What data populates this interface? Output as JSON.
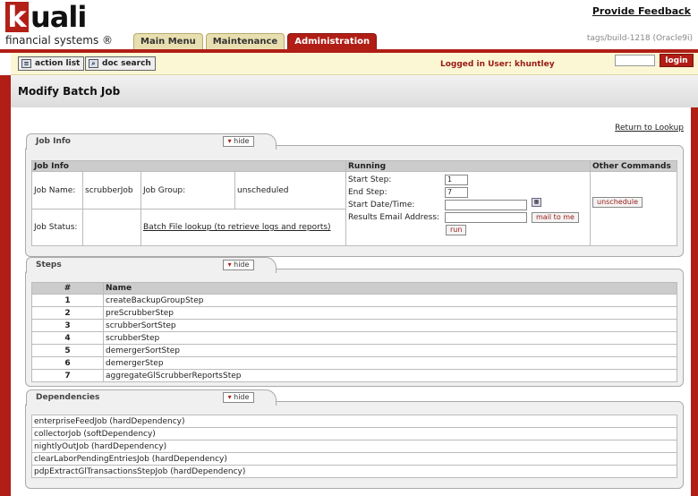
{
  "header": {
    "logo_word": "uali",
    "logo_k": "k",
    "logo_sub": "financial systems ®",
    "feedback_link": "Provide Feedback",
    "build": "tags/build-1218 (Oracle9i)",
    "tabs": [
      {
        "label": "Main Menu"
      },
      {
        "label": "Maintenance"
      },
      {
        "label": "Administration"
      }
    ]
  },
  "toolbar": {
    "action_list": "action list",
    "doc_search": "doc search",
    "logged_in": "Logged in User: khuntley",
    "login_label": "login"
  },
  "page": {
    "title": "Modify Batch Job",
    "return_link": "Return to Lookup"
  },
  "hide_label": "hide",
  "job_info": {
    "section_title": "Job Info",
    "headers": {
      "job_info": "Job Info",
      "running": "Running",
      "other": "Other Commands"
    },
    "job_name_label": "Job Name:",
    "job_name": "scrubberJob",
    "job_group_label": "Job Group:",
    "job_group": "unscheduled",
    "job_status_label": "Job Status:",
    "batch_link": "Batch File lookup (to retrieve logs and reports)",
    "start_step_label": "Start Step:",
    "start_step": "1",
    "end_step_label": "End Step:",
    "end_step": "7",
    "start_date_label": "Start Date/Time:",
    "email_label": "Results Email Address:",
    "mail_btn": "mail to me",
    "run_btn": "run",
    "unschedule_btn": "unschedule"
  },
  "steps": {
    "section_title": "Steps",
    "headers": {
      "num": "#",
      "name": "Name"
    },
    "rows": [
      {
        "num": "1",
        "name": "createBackupGroupStep"
      },
      {
        "num": "2",
        "name": "preScrubberStep"
      },
      {
        "num": "3",
        "name": "scrubberSortStep"
      },
      {
        "num": "4",
        "name": "scrubberStep"
      },
      {
        "num": "5",
        "name": "demergerSortStep"
      },
      {
        "num": "6",
        "name": "demergerStep"
      },
      {
        "num": "7",
        "name": "aggregateGlScrubberReportsStep"
      }
    ]
  },
  "dependencies": {
    "section_title": "Dependencies",
    "rows": [
      "enterpriseFeedJob (hardDependency)",
      "collectorJob (softDependency)",
      "nightlyOutJob (hardDependency)",
      "clearLaborPendingEntriesJob (hardDependency)",
      "pdpExtractGlTransactionsStepJob (hardDependency)"
    ]
  }
}
